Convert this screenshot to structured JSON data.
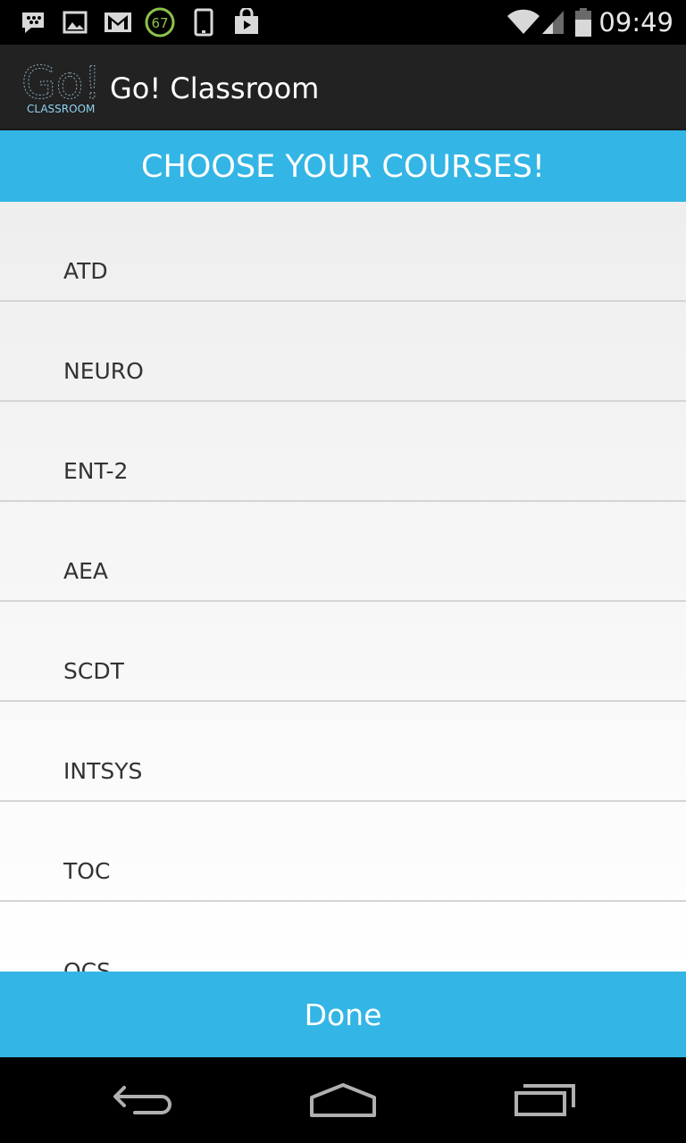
{
  "status_bar": {
    "time": "09:49",
    "battery_badge": "67",
    "icons": [
      "bbm-icon",
      "gallery-icon",
      "gmail-icon",
      "battery-widget-icon",
      "phone-icon",
      "play-store-icon",
      "wifi-icon",
      "signal-icon",
      "battery-icon"
    ]
  },
  "action_bar": {
    "title": "Go! Classroom",
    "logo_text": "Go!",
    "logo_subtext": "CLASSROOM"
  },
  "banner": {
    "text": "CHOOSE YOUR COURSES!"
  },
  "courses": [
    {
      "label": "ATD"
    },
    {
      "label": "NEURO"
    },
    {
      "label": "ENT-2"
    },
    {
      "label": "AEA"
    },
    {
      "label": "SCDT"
    },
    {
      "label": "INTSYS"
    },
    {
      "label": "TOC"
    },
    {
      "label": "OCS"
    }
  ],
  "done_button": {
    "label": "Done"
  },
  "nav_bar": {
    "icons": [
      "back-icon",
      "home-icon",
      "recent-apps-icon"
    ]
  },
  "colors": {
    "accent": "#33b5e5",
    "action_bar": "#222222",
    "status_bar": "#000000"
  }
}
